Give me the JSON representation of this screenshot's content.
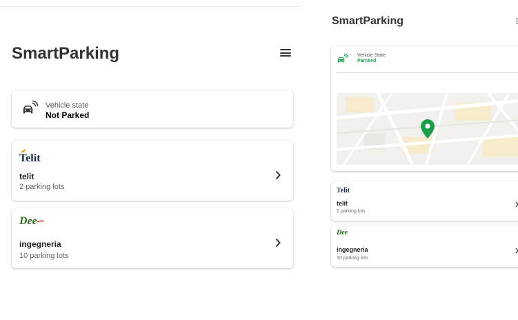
{
  "left": {
    "header": {
      "title": "SmartParking"
    },
    "vehicle_state": {
      "label": "Vehicle state",
      "value": "Not Parked"
    },
    "lots": [
      {
        "logo_text": "Telit",
        "name": "telit",
        "count": "2 parking lots"
      },
      {
        "logo_text": "Dee",
        "name": "ingegneria",
        "count": "10 parking lots"
      }
    ]
  },
  "right": {
    "header": {
      "title": "SmartParking"
    },
    "vehicle_state": {
      "label": "Vehicle State",
      "value": "Parcked"
    },
    "lots": [
      {
        "logo_text": "Telit",
        "name": "telit",
        "count": "2 parking lots"
      },
      {
        "logo_text": "Dee",
        "name": "ingegneria",
        "count": "10 parking lots"
      }
    ]
  },
  "icons": [
    "car-signal-icon",
    "chevron-right-icon",
    "menu-icon",
    "map-pin-icon"
  ],
  "colors": {
    "parked": "#1aa34a",
    "pin": "#1e9e4a",
    "text": "#222222",
    "subtext": "#666666"
  }
}
